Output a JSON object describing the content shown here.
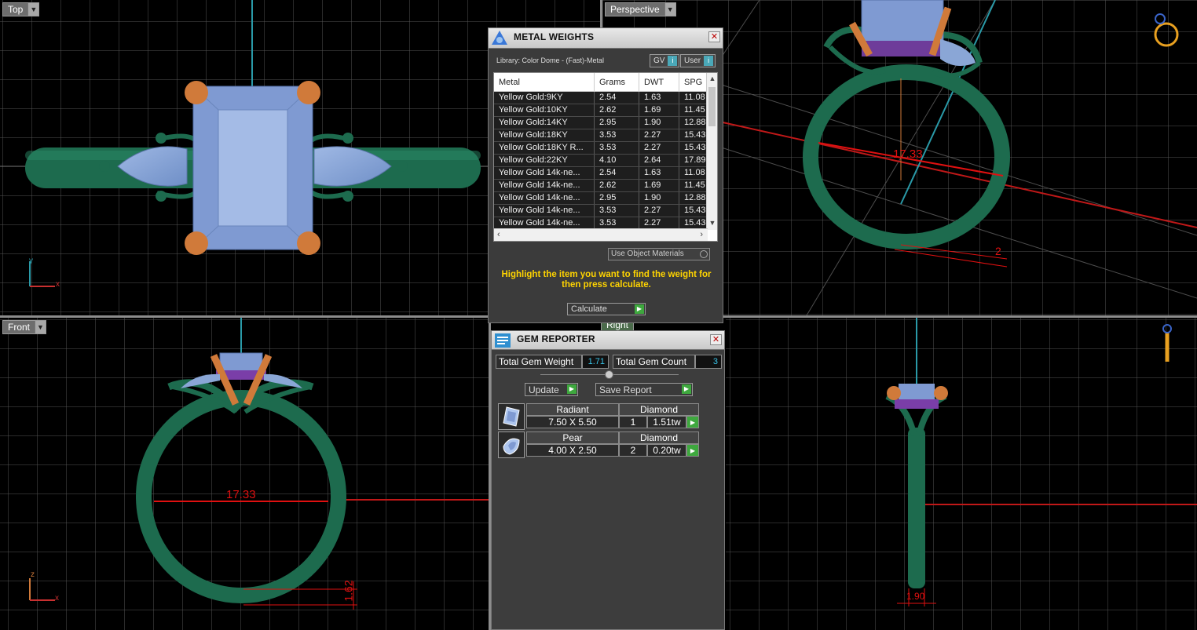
{
  "viewports": {
    "top": {
      "label": "Top",
      "axis_v": "y",
      "axis_h": "x"
    },
    "perspective": {
      "label": "Perspective",
      "dimension": "17.33",
      "dimension_small": "2"
    },
    "front": {
      "label": "Front",
      "dimension": "17.33",
      "dimension_small": "1.62",
      "axis_v": "z",
      "axis_h": "x"
    },
    "right": {
      "label": "Right",
      "dimension_small": "1.90"
    }
  },
  "metal_weights": {
    "title": "METAL WEIGHTS",
    "library": "Library: Color Dome - (Fast)-Metal",
    "chip_gv": "GV",
    "chip_user": "User",
    "columns": [
      "Metal",
      "Grams",
      "DWT",
      "SPG"
    ],
    "rows": [
      [
        "Yellow Gold:9KY",
        "2.54",
        "1.63",
        "11.08"
      ],
      [
        "Yellow Gold:10KY",
        "2.62",
        "1.69",
        "11.45"
      ],
      [
        "Yellow Gold:14KY",
        "2.95",
        "1.90",
        "12.88"
      ],
      [
        "Yellow Gold:18KY",
        "3.53",
        "2.27",
        "15.43"
      ],
      [
        "Yellow Gold:18KY R...",
        "3.53",
        "2.27",
        "15.43"
      ],
      [
        "Yellow Gold:22KY",
        "4.10",
        "2.64",
        "17.89"
      ],
      [
        "Yellow Gold 14k-ne...",
        "2.54",
        "1.63",
        "11.08"
      ],
      [
        "Yellow Gold 14k-ne...",
        "2.62",
        "1.69",
        "11.45"
      ],
      [
        "Yellow Gold 14k-ne...",
        "2.95",
        "1.90",
        "12.88"
      ],
      [
        "Yellow Gold 14k-ne...",
        "3.53",
        "2.27",
        "15.43"
      ],
      [
        "Yellow Gold 14k-ne...",
        "3.53",
        "2.27",
        "15.43"
      ]
    ],
    "use_object_materials": "Use Object Materials",
    "hint": "Highlight the item you want to find the weight for then press calculate.",
    "calculate": "Calculate"
  },
  "gem_reporter": {
    "title": "GEM REPORTER",
    "total_weight_label": "Total Gem Weight",
    "total_weight": "1.71",
    "total_count_label": "Total Gem Count",
    "total_count": "3",
    "update": "Update",
    "save_report": "Save Report",
    "gems": [
      {
        "shape": "Radiant",
        "material": "Diamond",
        "size": "7.50 X 5.50",
        "qty": "1",
        "weight": "1.51tw"
      },
      {
        "shape": "Pear",
        "material": "Diamond",
        "size": "4.00 X 2.50",
        "qty": "2",
        "weight": "0.20tw"
      }
    ]
  },
  "colors": {
    "metal": "#1e6e50",
    "prong": "#d07a3a",
    "gem": "#8aa6d6",
    "grid": "#555555",
    "dim": "#e01010",
    "axis": "#2a9aa8"
  }
}
